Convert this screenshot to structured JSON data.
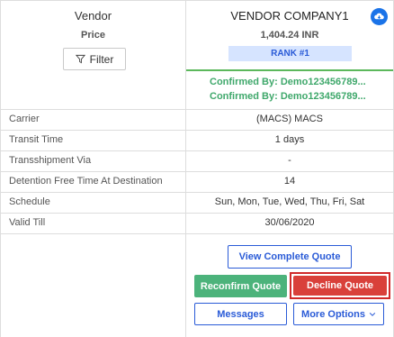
{
  "header_left": {
    "vendor_label": "Vendor",
    "price_label": "Price",
    "filter_button": "Filter"
  },
  "vendor": {
    "name": "VENDOR COMPANY1",
    "amount": "1,404.24 INR",
    "rank": "RANK #1",
    "confirmed": [
      "Confirmed By: Demo123456789...",
      "Confirmed By: Demo123456789..."
    ]
  },
  "rows": [
    {
      "label": "Carrier",
      "value": "(MACS) MACS"
    },
    {
      "label": "Transit Time",
      "value": "1 days"
    },
    {
      "label": "Transshipment Via",
      "value": "-"
    },
    {
      "label": "Detention Free Time At Destination",
      "value": "14"
    },
    {
      "label": "Schedule",
      "value": "Sun, Mon, Tue, Wed, Thu, Fri, Sat"
    },
    {
      "label": "Valid Till",
      "value": "30/06/2020"
    }
  ],
  "actions": {
    "view_complete_quote": "View Complete Quote",
    "reconfirm_quote": "Reconfirm Quote",
    "decline_quote": "Decline Quote",
    "messages": "Messages",
    "more_options": "More Options"
  },
  "colors": {
    "accent_blue": "#2a5bd7",
    "confirmed_green": "#3fa86b",
    "reconfirm_green": "#4cb37b",
    "decline_red": "#d9403a",
    "rank_badge_bg": "#d6e4ff",
    "cloud_icon_blue": "#1a73e8"
  },
  "icons": {
    "filter": "funnel-icon",
    "cloud": "cloud-download-icon",
    "more_options_caret": "chevron-down-icon"
  }
}
